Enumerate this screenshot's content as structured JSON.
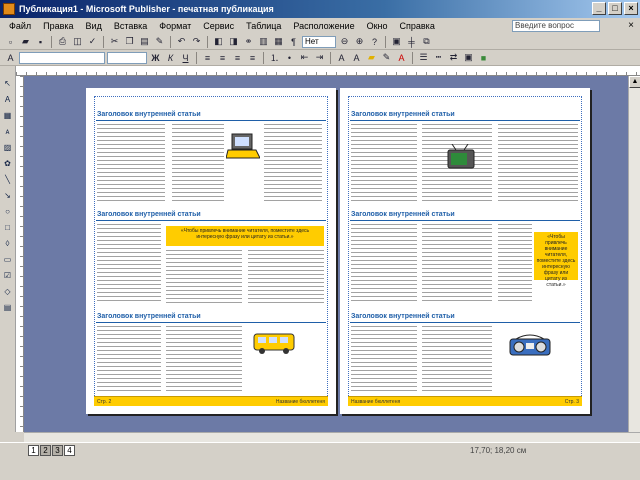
{
  "window": {
    "title": "Публикация1 - Microsoft Publisher - печатная публикация"
  },
  "menu": {
    "items": [
      "Файл",
      "Правка",
      "Вид",
      "Вставка",
      "Формат",
      "Сервис",
      "Таблица",
      "Расположение",
      "Окно",
      "Справка"
    ],
    "help_placeholder": "Введите вопрос"
  },
  "toolbar": {
    "font_size": "Нет"
  },
  "articles": {
    "title": "Заголовок внутренней статьи",
    "left_pullquote": "«Чтобы привлечь внимание читателя, поместите здесь интересную фразу или цитату из статьи.»",
    "right_pullquote": "«Чтобы привлечь внимание читателя, поместите здесь интересную фразу или цитату из статьи.»"
  },
  "footer": {
    "left_page": "Стр. 2",
    "left_name": "Название бюллетеня",
    "right_name": "Название бюллетеня",
    "right_page": "Стр. 3"
  },
  "statusbar": {
    "pages": [
      "1",
      "2",
      "3",
      "4"
    ],
    "position": "17,70; 18,20 см"
  },
  "colors": {
    "accent_yellow": "#ffcc00",
    "title_blue": "#1f5fa8",
    "workspace": "#6c7aa6"
  }
}
